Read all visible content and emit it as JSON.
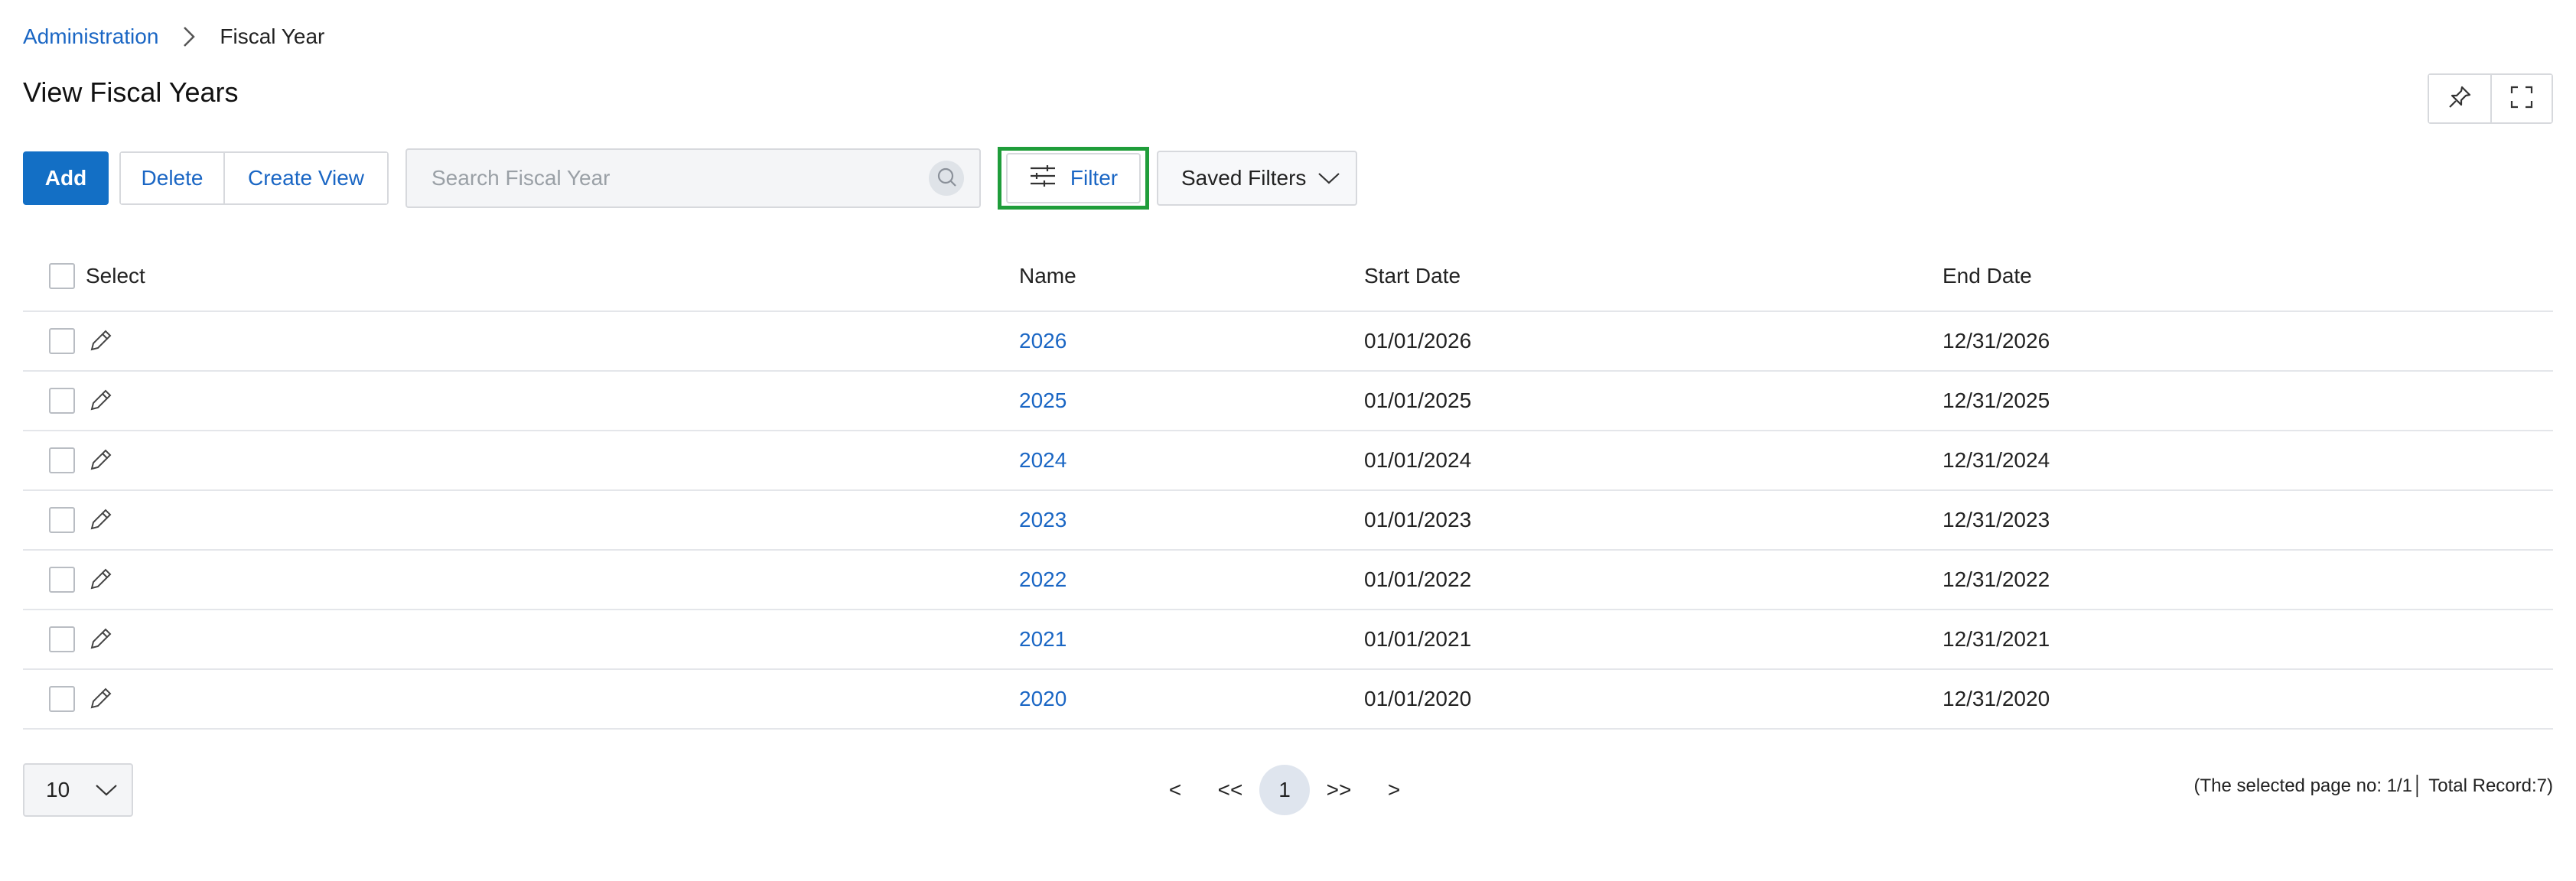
{
  "breadcrumb": {
    "parent": "Administration",
    "current": "Fiscal Year"
  },
  "page": {
    "title": "View Fiscal Years"
  },
  "toolbar": {
    "add_label": "Add",
    "delete_label": "Delete",
    "create_view_label": "Create View",
    "search_placeholder": "Search Fiscal Year",
    "search_value": "",
    "filter_label": "Filter",
    "saved_filters_label": "Saved Filters"
  },
  "table": {
    "headers": {
      "select": "Select",
      "name": "Name",
      "start_date": "Start Date",
      "end_date": "End Date"
    },
    "rows": [
      {
        "name": "2026",
        "start": "01/01/2026",
        "end": "12/31/2026"
      },
      {
        "name": "2025",
        "start": "01/01/2025",
        "end": "12/31/2025"
      },
      {
        "name": "2024",
        "start": "01/01/2024",
        "end": "12/31/2024"
      },
      {
        "name": "2023",
        "start": "01/01/2023",
        "end": "12/31/2023"
      },
      {
        "name": "2022",
        "start": "01/01/2022",
        "end": "12/31/2022"
      },
      {
        "name": "2021",
        "start": "01/01/2021",
        "end": "12/31/2021"
      },
      {
        "name": "2020",
        "start": "01/01/2020",
        "end": "12/31/2020"
      }
    ]
  },
  "footer": {
    "page_size": "10",
    "pagination": {
      "prev": "<",
      "first": "<<",
      "current": "1",
      "last": ">>",
      "next": ">"
    },
    "info": "(The selected page no: 1/1│ Total Record:7)"
  },
  "icons": {
    "breadcrumb_separator": "chevron-right-icon",
    "pin": "pin-icon",
    "fullscreen": "fullscreen-icon",
    "search": "search-icon",
    "filter": "sliders-icon",
    "saved_filters_dropdown": "chevron-down-icon",
    "edit": "pencil-icon",
    "page_size_dropdown": "chevron-down-icon"
  },
  "colors": {
    "accent": "#136fc5",
    "link": "#1a66c4",
    "highlight_border": "#1f9d3a"
  }
}
